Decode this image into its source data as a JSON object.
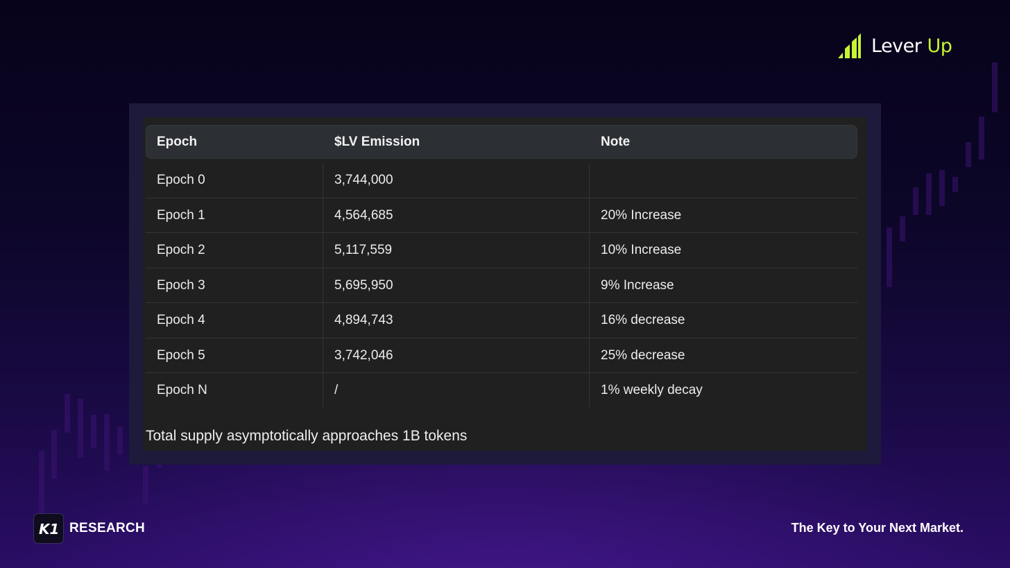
{
  "brand": {
    "name_part1": "Lever",
    "name_part2": "Up",
    "accent_color": "#c6f432",
    "icon": "ascending-bars-icon"
  },
  "table": {
    "columns": [
      "Epoch",
      "$LV Emission",
      "Note"
    ],
    "rows": [
      {
        "epoch": "Epoch 0",
        "emission": "3,744,000",
        "note": ""
      },
      {
        "epoch": "Epoch 1",
        "emission": "4,564,685",
        "note": "20% Increase"
      },
      {
        "epoch": "Epoch 2",
        "emission": "5,117,559",
        "note": "10% Increase"
      },
      {
        "epoch": "Epoch 3",
        "emission": "5,695,950",
        "note": "9% Increase"
      },
      {
        "epoch": "Epoch 4",
        "emission": "4,894,743",
        "note": "16% decrease"
      },
      {
        "epoch": "Epoch 5",
        "emission": "3,742,046",
        "note": "25% decrease"
      },
      {
        "epoch": "Epoch N",
        "emission": "/",
        "note": "1% weekly decay"
      }
    ],
    "footnote": "Total supply asymptotically approaches 1B tokens"
  },
  "footer": {
    "badge_text": "RESEARCH",
    "badge_logo": "K1",
    "tagline": "The Key to Your Next Market."
  }
}
